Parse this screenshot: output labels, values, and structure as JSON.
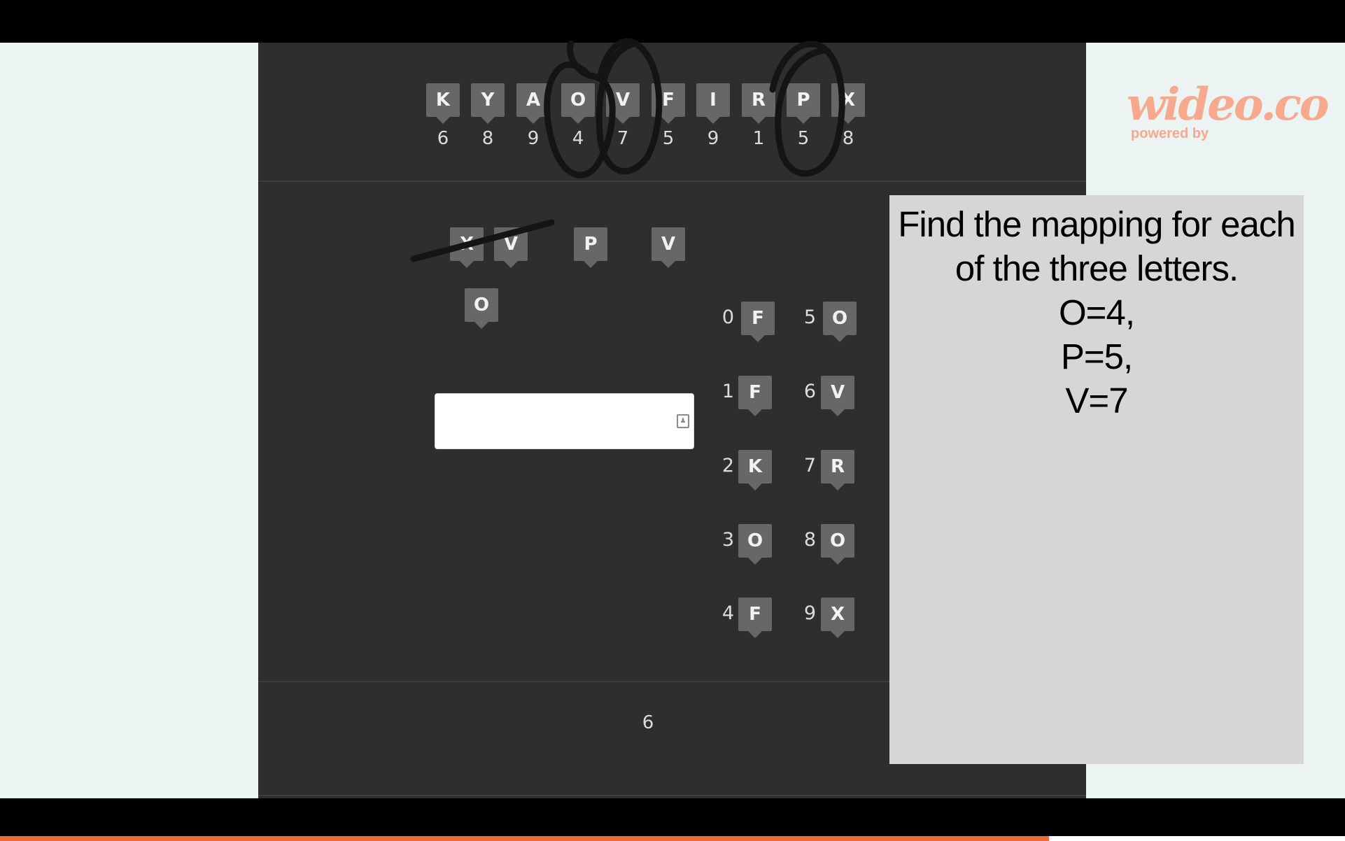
{
  "top_row": {
    "tiles": [
      "K",
      "Y",
      "A",
      "O",
      "V",
      "F",
      "I",
      "R",
      "P",
      "X"
    ],
    "numbers": [
      "6",
      "8",
      "9",
      "4",
      "7",
      "5",
      "9",
      "1",
      "5",
      "8"
    ]
  },
  "work_area": {
    "pending_tiles": [
      "X",
      "V",
      "P",
      "V",
      "O"
    ]
  },
  "mapping_grid": {
    "left_column": [
      {
        "digit": "0",
        "letter": "F"
      },
      {
        "digit": "1",
        "letter": "F"
      },
      {
        "digit": "2",
        "letter": "K"
      },
      {
        "digit": "3",
        "letter": "O"
      },
      {
        "digit": "4",
        "letter": "F"
      }
    ],
    "right_column": [
      {
        "digit": "5",
        "letter": "O"
      },
      {
        "digit": "6",
        "letter": "V"
      },
      {
        "digit": "7",
        "letter": "R"
      },
      {
        "digit": "8",
        "letter": "O"
      },
      {
        "digit": "9",
        "letter": "X"
      }
    ]
  },
  "answer_input": {
    "value": "",
    "placeholder": ""
  },
  "page_number": "6",
  "note": {
    "lines": [
      "Find the mapping for each",
      "of the three letters.",
      "O=4,",
      "P=5,",
      "V=7"
    ]
  },
  "brand": {
    "name": "wideo.co",
    "tagline": "powered by"
  },
  "video_progress": {
    "fraction": 0.78
  },
  "colors": {
    "accent": "#ee6a3a",
    "brand": "#f6a98c",
    "panel": "#2e2e2e",
    "tile": "#676767"
  }
}
